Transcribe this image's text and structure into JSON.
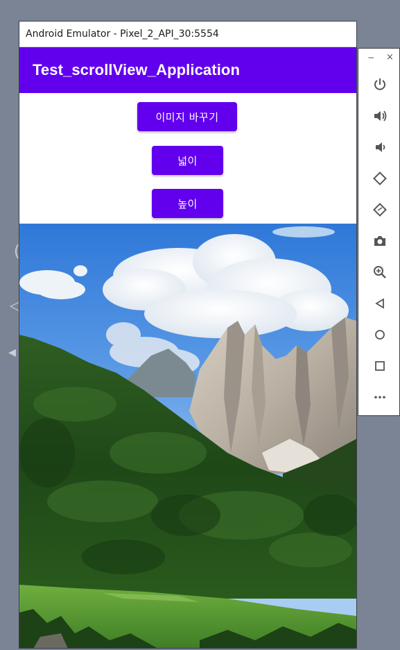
{
  "window": {
    "title": "Android Emulator - Pixel_2_API_30:5554"
  },
  "app_bar": {
    "title": "Test_scrollView_Application",
    "color": "#6200ee"
  },
  "buttons": {
    "change_image": "이미지 바꾸기",
    "width": "넓이",
    "height": "높이"
  },
  "side_panel": {
    "minimize": "−",
    "close": "×",
    "controls": [
      "power-icon",
      "volume-up-icon",
      "volume-down-icon",
      "rotate-left-icon",
      "rotate-right-icon",
      "camera-icon",
      "zoom-icon",
      "back-icon",
      "home-icon",
      "overview-icon",
      "more-icon"
    ]
  },
  "image": {
    "subject": "mountain landscape"
  }
}
